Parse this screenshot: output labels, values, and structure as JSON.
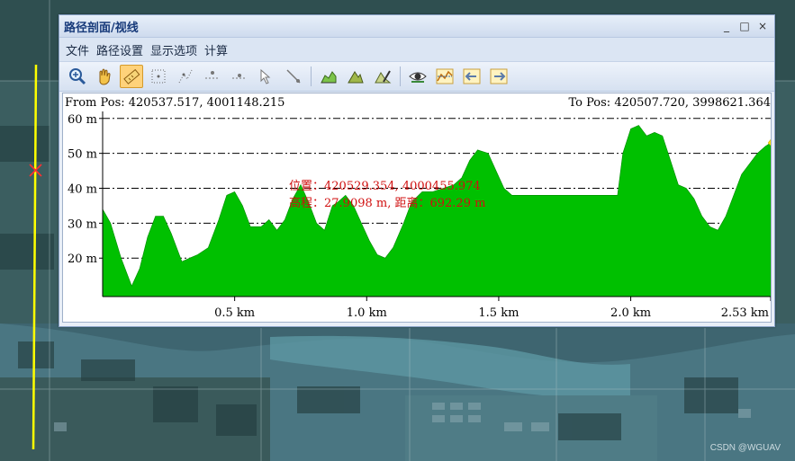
{
  "window": {
    "title": "路径剖面/视线",
    "minimize": "_",
    "maximize": "□",
    "close": "×"
  },
  "menu": [
    "文件",
    "路径设置",
    "显示选项",
    "计算"
  ],
  "toolbar": [
    {
      "name": "zoom-in-icon",
      "active": false
    },
    {
      "name": "pan-hand-icon",
      "active": false
    },
    {
      "name": "measure-ruler-icon",
      "active": true
    },
    {
      "name": "dotted-select-icon",
      "active": false
    },
    {
      "name": "dotted-path-icon",
      "active": false
    },
    {
      "name": "point-line-icon",
      "active": false
    },
    {
      "name": "point-line-2-icon",
      "active": false
    },
    {
      "name": "pointer-select-icon",
      "active": false
    },
    {
      "name": "line-pick-icon",
      "active": false
    },
    {
      "name": "separator"
    },
    {
      "name": "profile-chart-icon",
      "active": false
    },
    {
      "name": "terrain-icon",
      "active": false
    },
    {
      "name": "terrain-edit-icon",
      "active": false
    },
    {
      "name": "separator"
    },
    {
      "name": "viewshed-eye-icon",
      "active": false
    },
    {
      "name": "line-of-sight-icon",
      "active": false
    },
    {
      "name": "arrow-left-icon",
      "active": false
    },
    {
      "name": "arrow-right-icon",
      "active": false
    }
  ],
  "profile": {
    "from_label": "From Pos: 420537.517, 4001148.215",
    "to_label": "To Pos: 420507.720, 3998621.364",
    "cursor_pos": "位置：420529.354, 4000455.974",
    "cursor_info": "高程：27.9098 m, 距离：692.29 m"
  },
  "chart_data": {
    "type": "area",
    "xlabel": "",
    "ylabel": "",
    "x_unit": "km",
    "y_unit": "m",
    "xlim": [
      0,
      2.53
    ],
    "ylim": [
      9,
      62
    ],
    "x_ticks": [
      {
        "v": 0.5,
        "label": "0.5 km"
      },
      {
        "v": 1.0,
        "label": "1.0 km"
      },
      {
        "v": 1.5,
        "label": "1.5 km"
      },
      {
        "v": 2.0,
        "label": "2.0 km"
      },
      {
        "v": 2.53,
        "label": "2.53 km"
      }
    ],
    "y_ticks": [
      {
        "v": 20,
        "label": "20 m"
      },
      {
        "v": 30,
        "label": "30 m"
      },
      {
        "v": 40,
        "label": "40 m"
      },
      {
        "v": 50,
        "label": "50 m"
      },
      {
        "v": 60,
        "label": "60 m"
      }
    ],
    "gridlines_y": [
      12,
      20,
      30,
      40,
      50,
      60
    ],
    "grid_style": "dash-dot",
    "fill_color": "#00c000",
    "series": [
      {
        "x": [
          0,
          0.03,
          0.07,
          0.11,
          0.14,
          0.17,
          0.2,
          0.23,
          0.26,
          0.3,
          0.33,
          0.36,
          0.4,
          0.44,
          0.47,
          0.5,
          0.53,
          0.56,
          0.6,
          0.63,
          0.66,
          0.69,
          0.72,
          0.75,
          0.78,
          0.81,
          0.84,
          0.87,
          0.89,
          0.92,
          0.95,
          0.98,
          1.01,
          1.04,
          1.07,
          1.1,
          1.14,
          1.17,
          1.21,
          1.25,
          1.29,
          1.33,
          1.36,
          1.39,
          1.42,
          1.46,
          1.49,
          1.52,
          1.55,
          1.58,
          1.61,
          1.64,
          1.68,
          1.72,
          1.76,
          1.8,
          1.84,
          1.88,
          1.92,
          1.95,
          1.97,
          2.0,
          2.03,
          2.06,
          2.09,
          2.12,
          2.15,
          2.18,
          2.21,
          2.24,
          2.27,
          2.3,
          2.33,
          2.36,
          2.39,
          2.42,
          2.45,
          2.48,
          2.51,
          2.53
        ],
        "y": [
          34,
          30,
          20,
          12,
          17,
          26,
          32,
          32,
          27,
          19,
          20,
          21,
          23,
          31,
          38,
          39,
          35,
          29,
          29,
          31,
          28,
          31,
          37,
          41,
          36,
          30,
          28,
          35,
          36,
          38,
          35,
          30,
          25,
          21,
          20,
          23,
          30,
          36,
          39,
          39,
          40,
          41,
          43,
          48,
          51,
          50,
          45,
          40,
          38,
          38,
          38,
          38,
          38,
          38,
          38,
          38,
          38,
          38,
          38,
          38,
          50,
          57,
          58,
          55,
          56,
          55,
          48,
          41,
          40,
          37,
          32,
          29,
          28,
          32,
          38,
          44,
          47,
          50,
          52,
          53
        ]
      }
    ],
    "cursor_marker_x": 2.53,
    "cursor_marker_color": "#ffe000"
  }
}
